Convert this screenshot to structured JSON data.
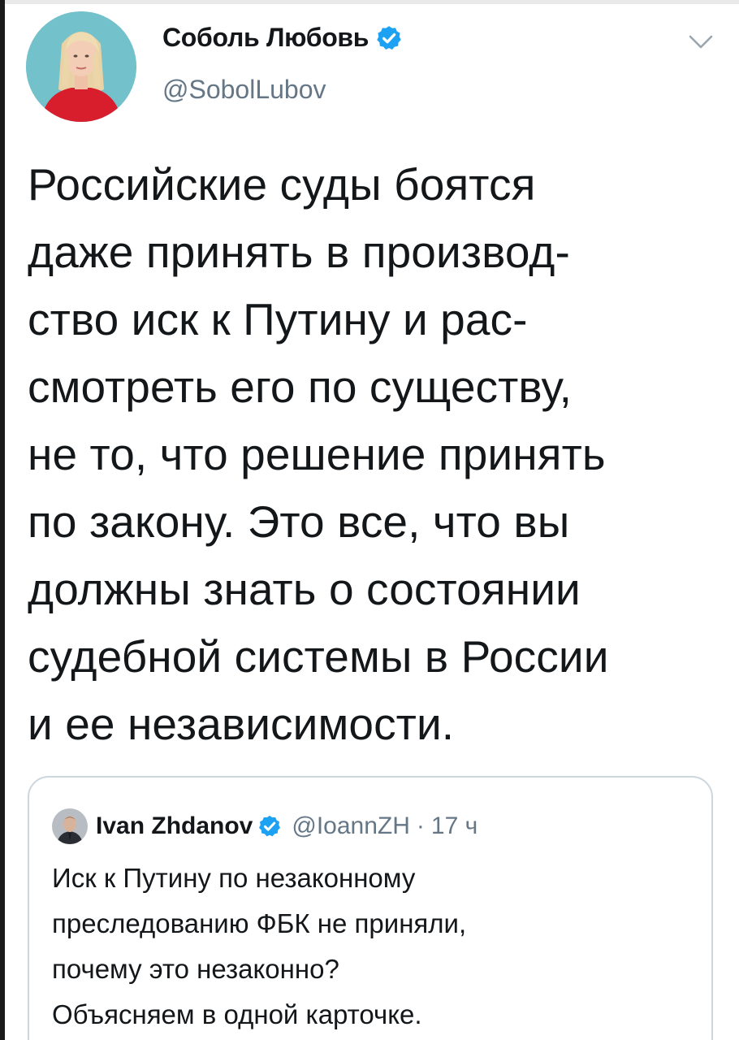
{
  "tweet": {
    "author": {
      "name": "Соболь Любовь",
      "handle": "@SobolLubov",
      "verified": true,
      "avatar_icon": "profile-photo"
    },
    "menu_icon": "chevron-down-icon",
    "text_lines": [
      "Российские суды боятся",
      "даже принять в производ-",
      "ство иск к Путину и рас-",
      "смотреть его по существу,",
      "не то, что решение принять",
      "по закону. Это все, что вы",
      "должны знать о состоянии",
      "судебной системы в России",
      "и ее независимости."
    ]
  },
  "quoted_tweet": {
    "author": {
      "name": "Ivan Zhdanov",
      "handle": "@IoannZH",
      "verified": true
    },
    "separator": "·",
    "time": "17 ч",
    "text_lines": [
      "Иск к Путину по незаконному",
      "преследованию ФБК не приняли,",
      "почему это незаконно?",
      "Объясняем в одной карточке."
    ]
  },
  "colors": {
    "primary_text": "#14171a",
    "secondary_text": "#657786",
    "verified_blue": "#1da1f2",
    "card_border": "#ccd6dd"
  }
}
